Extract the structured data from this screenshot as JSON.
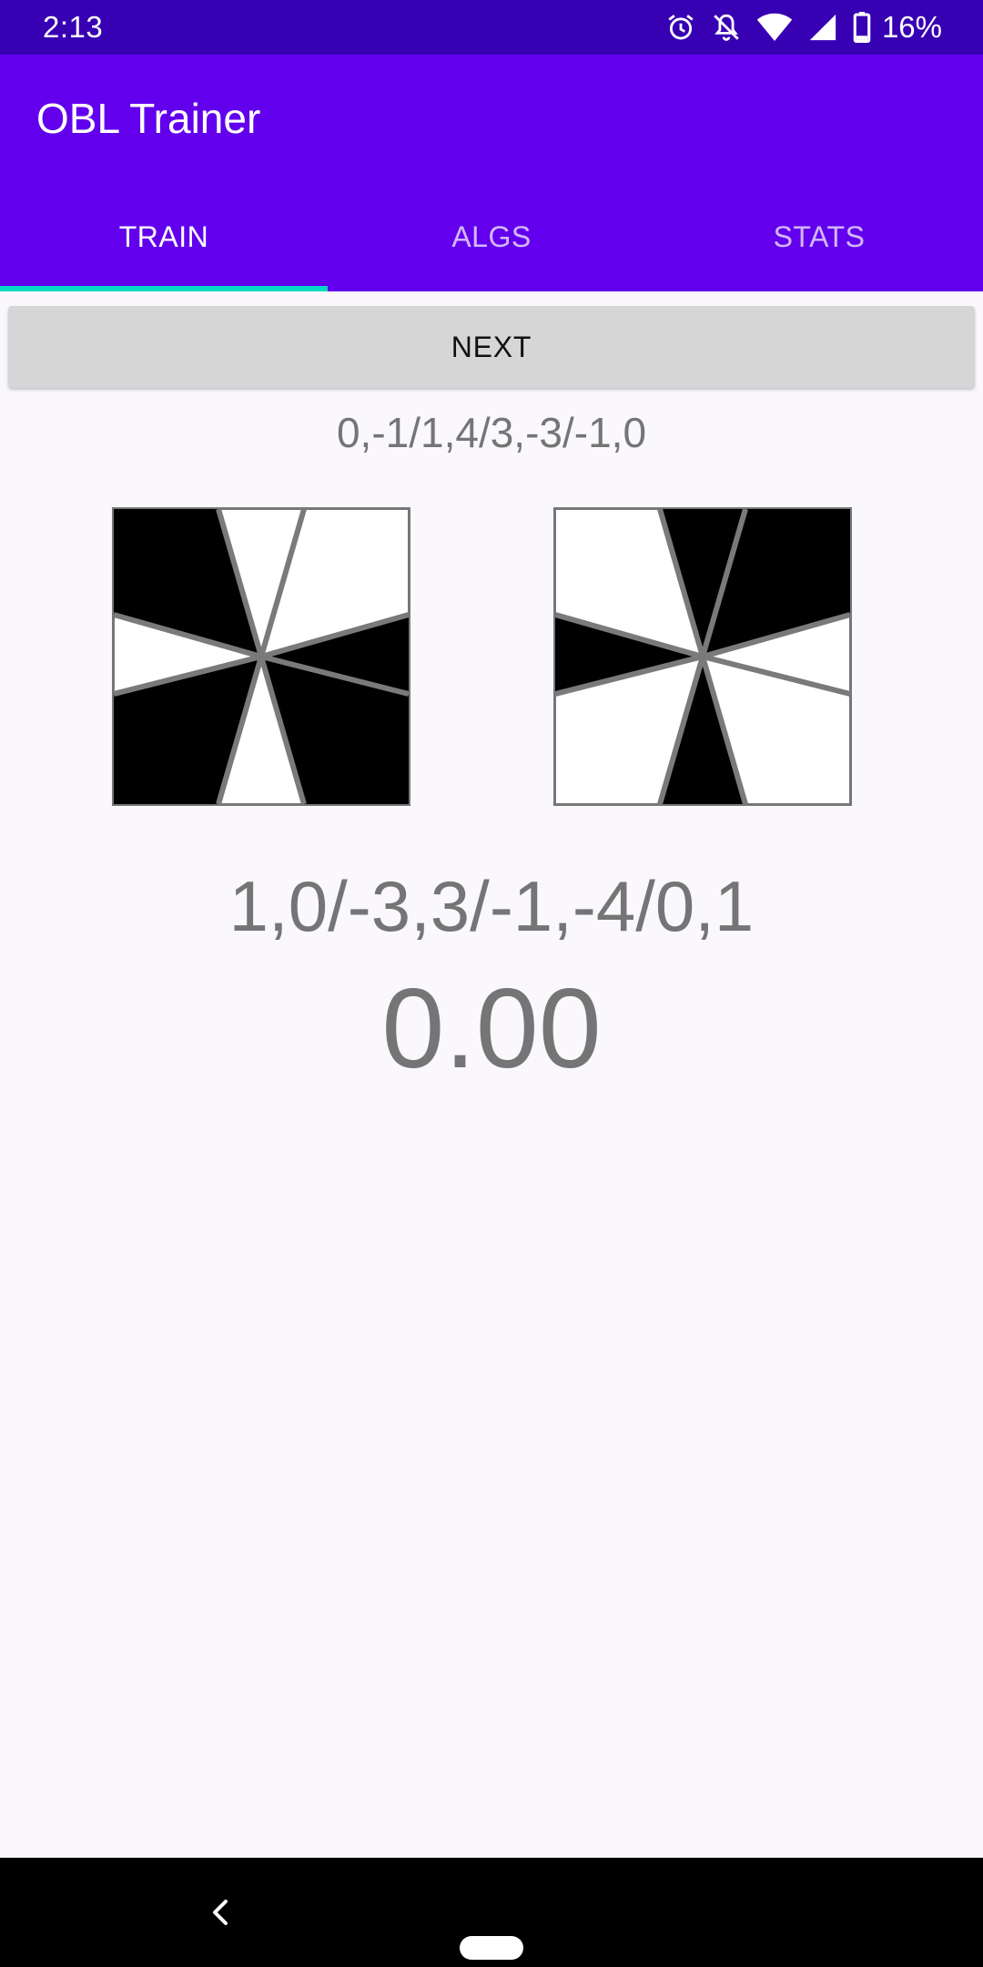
{
  "status_bar": {
    "time": "2:13",
    "battery_percent": "16%",
    "icons": [
      "alarm-icon",
      "notifications-off-icon",
      "wifi-icon",
      "cell-signal-icon",
      "battery-icon"
    ],
    "background": "#3700B3"
  },
  "app_bar": {
    "title": "OBL Trainer",
    "background": "#6200EE"
  },
  "tabs": [
    {
      "label": "TRAIN",
      "selected": true
    },
    {
      "label": "ALGS",
      "selected": false
    },
    {
      "label": "STATS",
      "selected": false
    }
  ],
  "tab_indicator_color": "#03DAC5",
  "train": {
    "next_button_label": "NEXT",
    "scramble": "0,-1/1,4/3,-3/-1,0",
    "solution": "1,0/-3,3/-1,-4/0,1",
    "timer": "0.00"
  },
  "navigation_bar": {
    "icons": [
      "back-icon",
      "home-pill"
    ]
  }
}
